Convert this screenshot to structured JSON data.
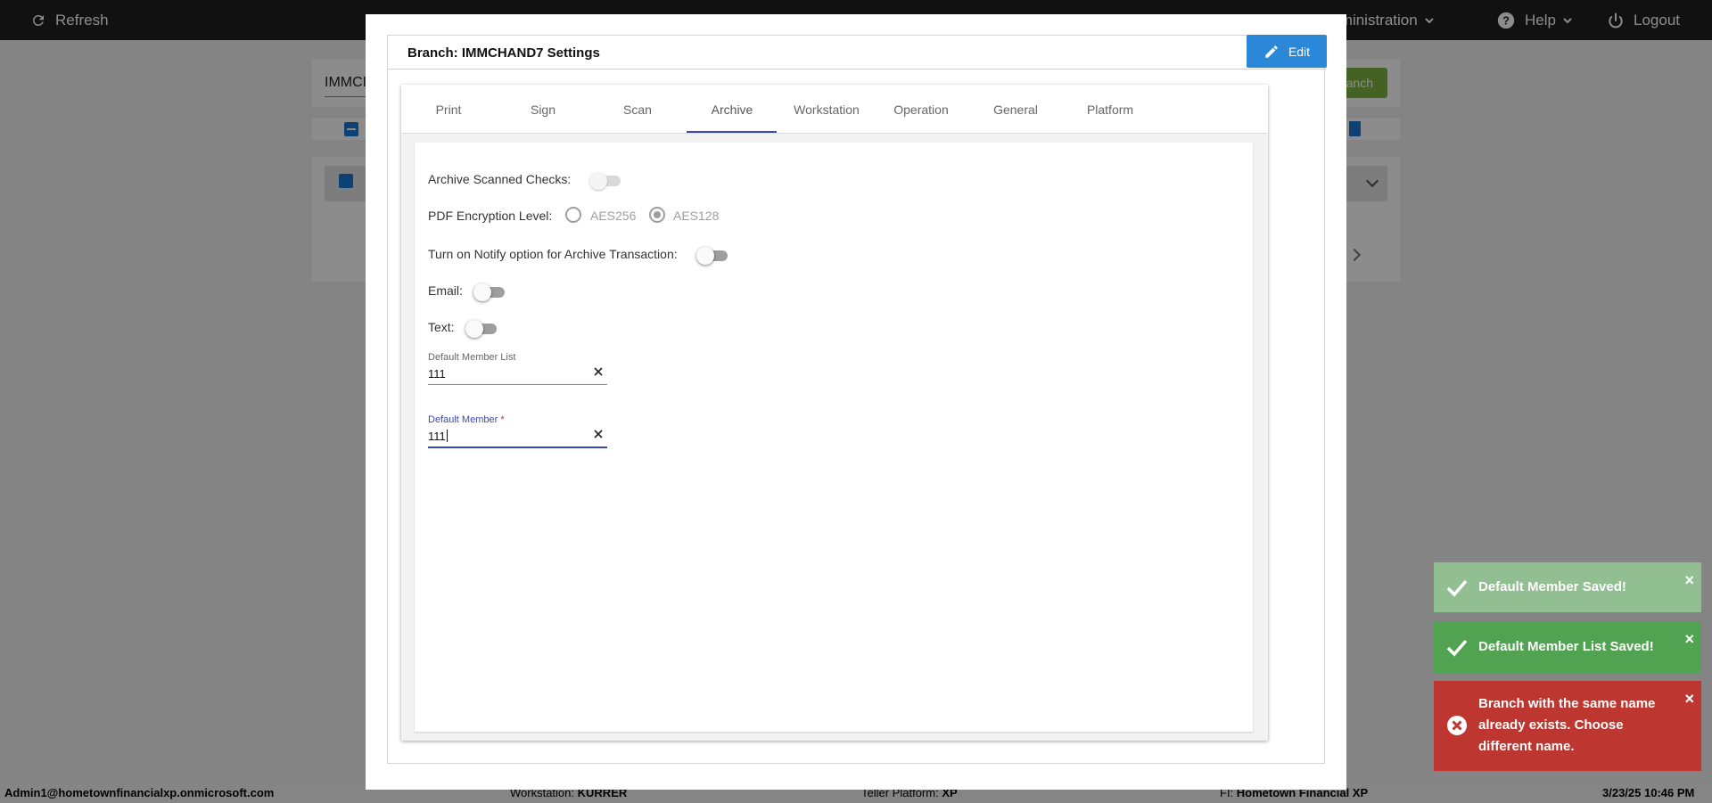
{
  "topbar": {
    "refresh_label": "Refresh",
    "administration_label": "Administration",
    "help_label": "Help",
    "logout_label": "Logout"
  },
  "background": {
    "search_value": "IMMCI",
    "search_button_label": "anch"
  },
  "statusbar": {
    "user": "Admin1@hometownfinancialxp.onmicrosoft.com",
    "workstation_label": "Workstation:",
    "workstation_value": "KURRER",
    "teller_platform_label": "Teller Platform:",
    "teller_platform_value": "XP",
    "fi_label": "FI:",
    "fi_value": "Hometown Financial XP",
    "datetime": "3/23/25 10:46 PM"
  },
  "modal": {
    "title": "Branch: IMMCHAND7 Settings",
    "edit_label": "Edit",
    "tabs": [
      {
        "label": "Print",
        "active": false
      },
      {
        "label": "Sign",
        "active": false
      },
      {
        "label": "Scan",
        "active": false
      },
      {
        "label": "Archive",
        "active": true
      },
      {
        "label": "Workstation",
        "active": false
      },
      {
        "label": "Operation",
        "active": false
      },
      {
        "label": "General",
        "active": false
      },
      {
        "label": "Platform",
        "active": false
      }
    ],
    "archive": {
      "archive_scanned_checks_label": "Archive Scanned Checks:",
      "archive_scanned_checks_on": false,
      "pdf_encryption_label": "PDF Encryption Level:",
      "pdf_options": [
        "AES256",
        "AES128"
      ],
      "pdf_selected": "AES128",
      "notify_label": "Turn on Notify option for Archive Transaction:",
      "notify_on": false,
      "email_label": "Email:",
      "email_on": false,
      "text_label": "Text:",
      "text_on": false,
      "default_member_list_label": "Default Member List",
      "default_member_list_value": "111",
      "default_member_label": "Default Member",
      "default_member_required_mark": "*",
      "default_member_value": "111"
    }
  },
  "toasts": [
    {
      "type": "success",
      "message": "Default Member Saved!",
      "color": "#92bf92"
    },
    {
      "type": "success",
      "message": "Default Member List Saved!",
      "color": "#51a351"
    },
    {
      "type": "error",
      "message": "Branch with the same name already exists. Choose different name.",
      "color": "#bd362f"
    }
  ],
  "colors": {
    "topbar": "#202020",
    "accent": "#3949ab",
    "edit_button": "#2b88d8"
  }
}
